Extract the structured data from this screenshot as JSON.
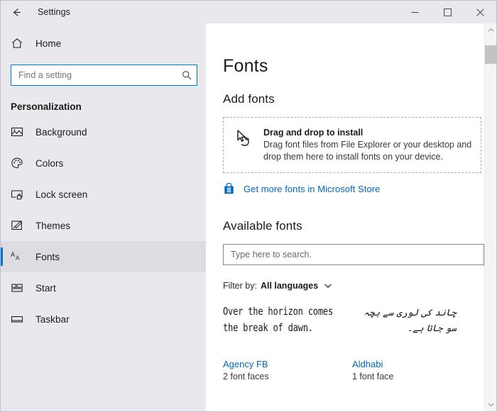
{
  "window": {
    "app_title": "Settings",
    "back_icon": "back-arrow-icon",
    "minimize_label": "Minimize",
    "maximize_label": "Maximize",
    "close_label": "Close"
  },
  "sidebar": {
    "home": {
      "label": "Home",
      "icon": "home-icon"
    },
    "search": {
      "placeholder": "Find a setting",
      "value": "",
      "icon": "search-icon"
    },
    "section_header": "Personalization",
    "items": [
      {
        "label": "Background",
        "icon": "picture-icon",
        "selected": false
      },
      {
        "label": "Colors",
        "icon": "palette-icon",
        "selected": false
      },
      {
        "label": "Lock screen",
        "icon": "lock-screen-icon",
        "selected": false
      },
      {
        "label": "Themes",
        "icon": "brush-icon",
        "selected": false
      },
      {
        "label": "Fonts",
        "icon": "font-aa-icon",
        "selected": true
      },
      {
        "label": "Start",
        "icon": "start-tiles-icon",
        "selected": false
      },
      {
        "label": "Taskbar",
        "icon": "taskbar-icon",
        "selected": false
      }
    ]
  },
  "main": {
    "page_title": "Fonts",
    "add_fonts": {
      "heading": "Add fonts",
      "dropzone_icon": "drag-drop-cursor-icon",
      "dropzone_title": "Drag and drop to install",
      "dropzone_description": "Drag font files from File Explorer or your desktop and drop them here to install fonts on your device.",
      "store_link_icon": "microsoft-store-icon",
      "store_link_text": "Get more fonts in Microsoft Store"
    },
    "available_fonts": {
      "heading": "Available fonts",
      "search": {
        "placeholder": "Type here to search.",
        "value": ""
      },
      "filter_label": "Filter by:",
      "filter_value": "All languages",
      "filter_chevron_icon": "chevron-down-icon",
      "fonts": [
        {
          "preview_text": "Over the horizon comes the break of dawn.",
          "preview_script": "latin",
          "name": "Agency FB",
          "faces": "2 font faces"
        },
        {
          "preview_text": "چاند کی لوری سے بچہ سو جاتا ہے۔",
          "preview_script": "urdu",
          "name": "Aldhabi",
          "faces": "1 font face"
        }
      ]
    }
  },
  "scrollbar": {
    "up_icon": "chevron-up-icon",
    "down_icon": "chevron-down-icon"
  },
  "colors": {
    "accent": "#0078d4",
    "link": "#0067c0",
    "sidebar_bg": "#e9e9ed",
    "content_bg": "#ffffff",
    "window_border": "#c8b9d0"
  }
}
